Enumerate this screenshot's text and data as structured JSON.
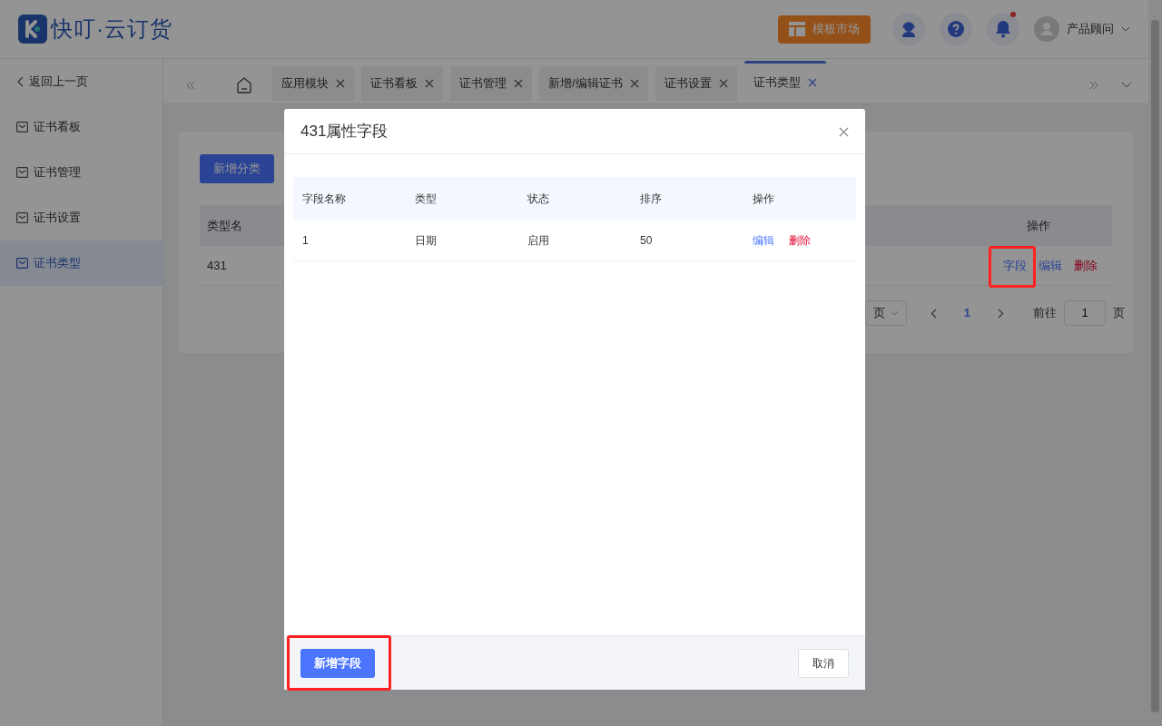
{
  "app": {
    "logo_text": "快叮·云订货"
  },
  "header": {
    "market_button": "模板市场",
    "has_notification": true,
    "user_name": "产品顾问"
  },
  "sidebar": {
    "back": "返回上一页",
    "items": [
      {
        "label": "证书看板",
        "selected": false
      },
      {
        "label": "证书管理",
        "selected": false
      },
      {
        "label": "证书设置",
        "selected": false
      },
      {
        "label": "证书类型",
        "selected": true
      }
    ]
  },
  "tabs": [
    {
      "label": "应用模块",
      "selected": false
    },
    {
      "label": "证书看板",
      "selected": false
    },
    {
      "label": "证书管理",
      "selected": false
    },
    {
      "label": "新增/编辑证书",
      "selected": false
    },
    {
      "label": "证书设置",
      "selected": false
    },
    {
      "label": "证书类型",
      "selected": true
    }
  ],
  "page": {
    "add_button": "新增分类",
    "table": {
      "columns": [
        "类型名",
        "操作"
      ],
      "rows": [
        {
          "cells": [
            "431"
          ],
          "actions": [
            {
              "label": "字段",
              "kind": "link",
              "highlighted": true
            },
            {
              "label": "编辑",
              "kind": "link",
              "highlighted": false
            },
            {
              "label": "删除",
              "kind": "danger",
              "highlighted": false
            }
          ]
        }
      ]
    },
    "pagination": {
      "page_size_suffix": "页",
      "current": "1",
      "goto_label": "前往",
      "goto_value": "1",
      "goto_suffix": "页"
    }
  },
  "modal": {
    "title": "431属性字段",
    "columns": [
      "字段名称",
      "类型",
      "状态",
      "排序",
      "操作"
    ],
    "rows": [
      {
        "cells": [
          "1",
          "日期",
          "启用",
          "50"
        ],
        "actions": [
          {
            "label": "编辑",
            "kind": "link"
          },
          {
            "label": "删除",
            "kind": "danger"
          }
        ]
      }
    ],
    "primary_button": {
      "label": "新增字段",
      "highlighted": true
    },
    "cancel_button": "取消"
  }
}
